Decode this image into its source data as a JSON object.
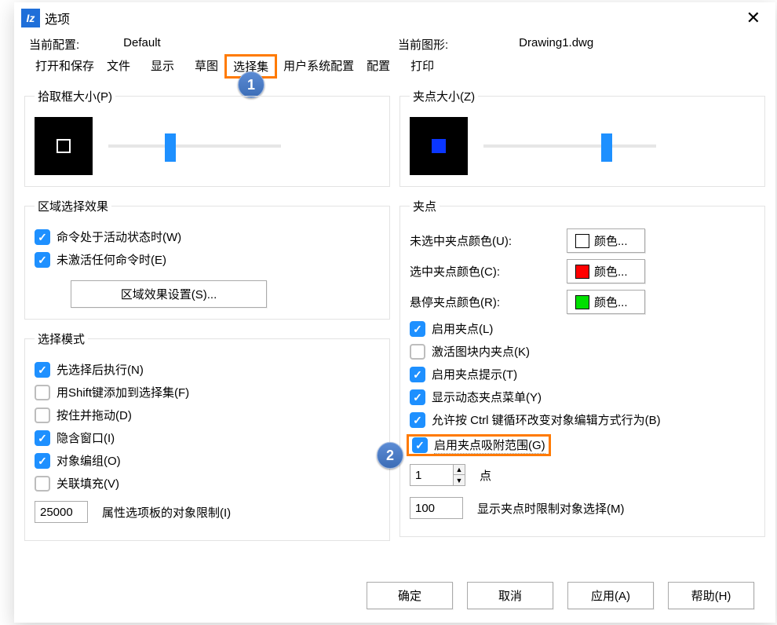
{
  "window": {
    "title": "选项"
  },
  "profile": {
    "current_profile_label": "当前配置:",
    "current_profile_value": "Default",
    "current_drawing_label": "当前图形:",
    "current_drawing_value": "Drawing1.dwg"
  },
  "tabs": {
    "open_save": "打开和保存",
    "file": "文件",
    "display": "显示",
    "sketch": "草图",
    "selection": "选择集",
    "user_system": "用户系统配置",
    "config": "配置",
    "print": "打印"
  },
  "callouts": {
    "one": "1",
    "two": "2"
  },
  "left": {
    "pickbox_legend": "拾取框大小(P)",
    "region_legend": "区域选择效果",
    "cmd_active": "命令处于活动状态时(W)",
    "cmd_inactive": "未激活任何命令时(E)",
    "region_settings_btn": "区域效果设置(S)...",
    "mode_legend": "选择模式",
    "noun_verb": "先选择后执行(N)",
    "shift_add": "用Shift键添加到选择集(F)",
    "press_drag": "按住并拖动(D)",
    "implied_window": "隐含窗口(I)",
    "object_group": "对象编组(O)",
    "assoc_hatch": "关联填充(V)",
    "limit_value": "25000",
    "limit_label": "属性选项板的对象限制(I)"
  },
  "right": {
    "gripsize_legend": "夹点大小(Z)",
    "grips_legend": "夹点",
    "unsel_color_label": "未选中夹点颜色(U):",
    "sel_color_label": "选中夹点颜色(C):",
    "hover_color_label": "悬停夹点颜色(R):",
    "color_btn_text": "颜色...",
    "enable_grips": "启用夹点(L)",
    "block_grips": "激活图块内夹点(K)",
    "grip_tips": "启用夹点提示(T)",
    "dyn_menu": "显示动态夹点菜单(Y)",
    "ctrl_cycle": "允许按 Ctrl 键循环改变对象编辑方式行为(B)",
    "grip_snap": "启用夹点吸附范围(G)",
    "snap_value": "1",
    "snap_unit": "点",
    "limit_value": "100",
    "limit_label": "显示夹点时限制对象选择(M)",
    "colors": {
      "unselected": "#0000ff",
      "selected": "#ff0000",
      "hover": "#00e000"
    }
  },
  "footer": {
    "ok": "确定",
    "cancel": "取消",
    "apply": "应用(A)",
    "help": "帮助(H)"
  }
}
